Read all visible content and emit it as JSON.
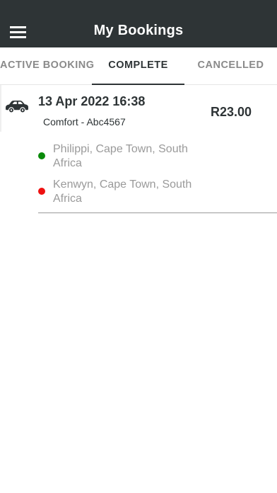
{
  "header": {
    "title": "My Bookings",
    "menu_icon": "hamburger-menu-icon",
    "background": "#2e3436"
  },
  "tabs": [
    {
      "label": "ACTIVE BOOKING",
      "active": false
    },
    {
      "label": "COMPLETE",
      "active": true
    },
    {
      "label": "CANCELLED",
      "active": false
    }
  ],
  "bookings": [
    {
      "icon": "car-icon",
      "date": "13 Apr 2022 16:38",
      "vehicle": "Comfort - Abc4567",
      "price": "R23.00",
      "pickup": "Philippi, Cape Town, South Africa",
      "dropoff": "Kenwyn, Cape Town, South Africa",
      "pickup_color": "#0a8a0a",
      "dropoff_color": "#ee1111"
    }
  ]
}
